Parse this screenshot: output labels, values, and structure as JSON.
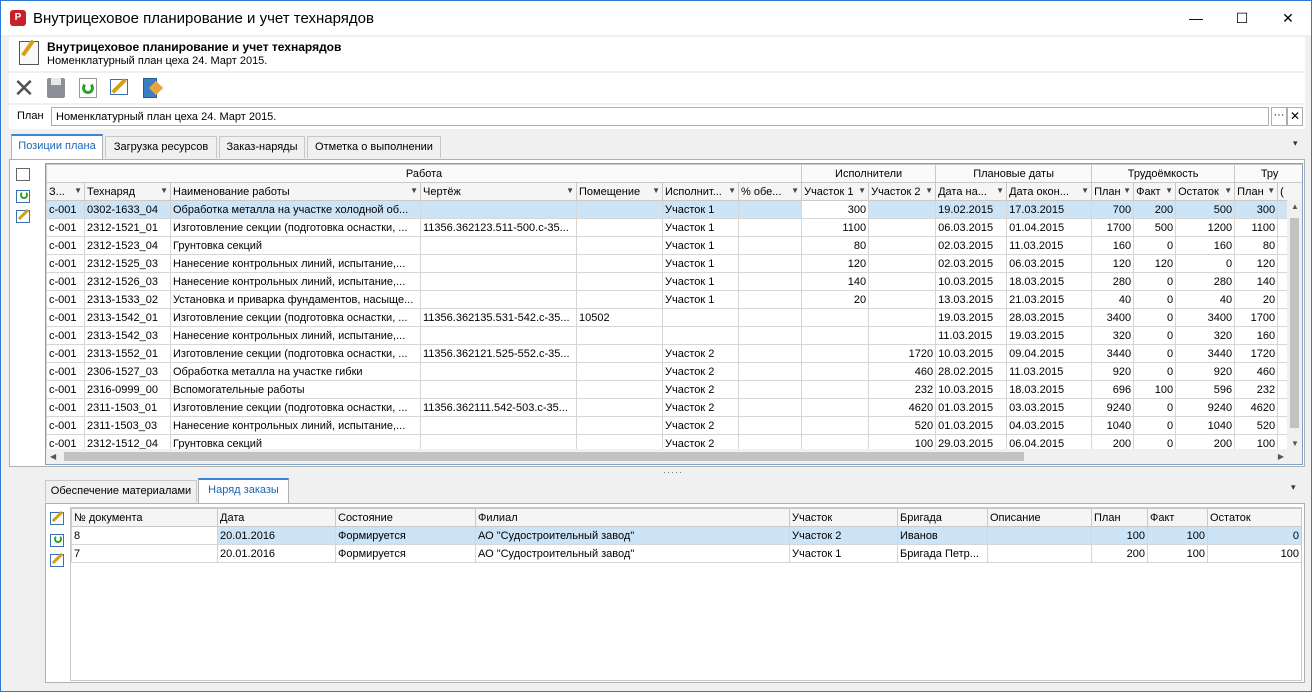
{
  "window": {
    "title": "Внутрицеховое планирование и учет технарядов",
    "controls": {
      "min": "—",
      "max": "☐",
      "close": "✕"
    }
  },
  "header": {
    "title": "Внутрицеховое планирование и учет технарядов",
    "subtitle": "Номенклатурный план цеха 24. Март 2015."
  },
  "toolbar": {
    "icons": [
      "delete-icon",
      "save-icon",
      "refresh-icon",
      "edit-icon",
      "exit-icon"
    ]
  },
  "plan": {
    "label": "План",
    "value": "Номенклатурный план цеха 24. Март 2015.",
    "dots": "···",
    "clear": "✕"
  },
  "tabs_top": [
    "Позиции плана",
    "Загрузка ресурсов",
    "Заказ-наряды",
    "Отметка о выполнении"
  ],
  "tabs_bottom": [
    "Обеспечение материалами",
    "Наряд заказы"
  ],
  "grid1": {
    "bands": [
      "Работа",
      "Исполнители",
      "Плановые даты",
      "Трудоёмкость",
      "Тру"
    ],
    "columns": [
      "З...",
      "Технаряд",
      "Наименование работы",
      "Чертёж",
      "Помещение",
      "Исполнит...",
      "% обе...",
      "Участок 1",
      "Участок 2",
      "Дата на...",
      "Дата окон...",
      "План",
      "Факт",
      "Остаток",
      "План",
      "("
    ],
    "rows": [
      [
        "с-001",
        "0302-1633_04",
        "Обработка металла на участке холодной об...",
        "",
        "",
        "Участок 1",
        "",
        "300",
        "",
        "19.02.2015",
        "17.03.2015",
        "700",
        "200",
        "500",
        "300"
      ],
      [
        "с-001",
        "2312-1521_01",
        "Изготовление секции (подготовка оснастки, ...",
        "11356.362123.511-500.с-35...",
        "",
        "Участок 1",
        "",
        "1100",
        "",
        "06.03.2015",
        "01.04.2015",
        "1700",
        "500",
        "1200",
        "1100"
      ],
      [
        "с-001",
        "2312-1523_04",
        "Грунтовка секций",
        "",
        "",
        "Участок 1",
        "",
        "80",
        "",
        "02.03.2015",
        "11.03.2015",
        "160",
        "0",
        "160",
        "80"
      ],
      [
        "с-001",
        "2312-1525_03",
        "Нанесение контрольных линий, испытание,...",
        "",
        "",
        "Участок 1",
        "",
        "120",
        "",
        "02.03.2015",
        "06.03.2015",
        "120",
        "120",
        "0",
        "120"
      ],
      [
        "с-001",
        "2312-1526_03",
        "Нанесение контрольных линий, испытание,...",
        "",
        "",
        "Участок 1",
        "",
        "140",
        "",
        "10.03.2015",
        "18.03.2015",
        "280",
        "0",
        "280",
        "140"
      ],
      [
        "с-001",
        "2313-1533_02",
        "Установка и приварка фундаментов, насыще...",
        "",
        "",
        "Участок 1",
        "",
        "20",
        "",
        "13.03.2015",
        "21.03.2015",
        "40",
        "0",
        "40",
        "20"
      ],
      [
        "с-001",
        "2313-1542_01",
        "Изготовление секции (подготовка оснастки, ...",
        "11356.362135.531-542.с-35...",
        "10502",
        "",
        "",
        "",
        "",
        "19.03.2015",
        "28.03.2015",
        "3400",
        "0",
        "3400",
        "1700"
      ],
      [
        "с-001",
        "2313-1542_03",
        "Нанесение контрольных линий, испытание,...",
        "",
        "",
        "",
        "",
        "",
        "",
        "11.03.2015",
        "19.03.2015",
        "320",
        "0",
        "320",
        "160"
      ],
      [
        "с-001",
        "2313-1552_01",
        "Изготовление секции (подготовка оснастки, ...",
        "11356.362121.525-552.с-35...",
        "",
        "Участок 2",
        "",
        "",
        "1720",
        "10.03.2015",
        "09.04.2015",
        "3440",
        "0",
        "3440",
        "1720"
      ],
      [
        "с-001",
        "2306-1527_03",
        "Обработка металла на участке гибки",
        "",
        "",
        "Участок 2",
        "",
        "",
        "460",
        "28.02.2015",
        "11.03.2015",
        "920",
        "0",
        "920",
        "460"
      ],
      [
        "с-001",
        "2316-0999_00",
        "Вспомогательные работы",
        "",
        "",
        "Участок 2",
        "",
        "",
        "232",
        "10.03.2015",
        "18.03.2015",
        "696",
        "100",
        "596",
        "232"
      ],
      [
        "с-001",
        "2311-1503_01",
        "Изготовление секции (подготовка оснастки, ...",
        "11356.362111.542-503.с-35...",
        "",
        "Участок 2",
        "",
        "",
        "4620",
        "01.03.2015",
        "03.03.2015",
        "9240",
        "0",
        "9240",
        "4620"
      ],
      [
        "с-001",
        "2311-1503_03",
        "Нанесение контрольных линий, испытание,...",
        "",
        "",
        "Участок 2",
        "",
        "",
        "520",
        "01.03.2015",
        "04.03.2015",
        "1040",
        "0",
        "1040",
        "520"
      ],
      [
        "с-001",
        "2312-1512_04",
        "Грунтовка секций",
        "",
        "",
        "Участок 2",
        "",
        "",
        "100",
        "29.03.2015",
        "06.04.2015",
        "200",
        "0",
        "200",
        "100"
      ]
    ]
  },
  "splitter": "·····",
  "grid2": {
    "columns": [
      "№ документа",
      "Дата",
      "Состояние",
      "Филиал",
      "Участок",
      "Бригада",
      "Описание",
      "План",
      "Факт",
      "Остаток"
    ],
    "rows": [
      [
        "8",
        "20.01.2016",
        "Формируется",
        "АО \"Судостроительный завод\"",
        "Участок 2",
        "Иванов",
        "",
        "100",
        "100",
        "0"
      ],
      [
        "7",
        "20.01.2016",
        "Формируется",
        "АО \"Судостроительный завод\"",
        "Участок 1",
        "Бригада Петр...",
        "",
        "200",
        "100",
        "100"
      ]
    ]
  }
}
